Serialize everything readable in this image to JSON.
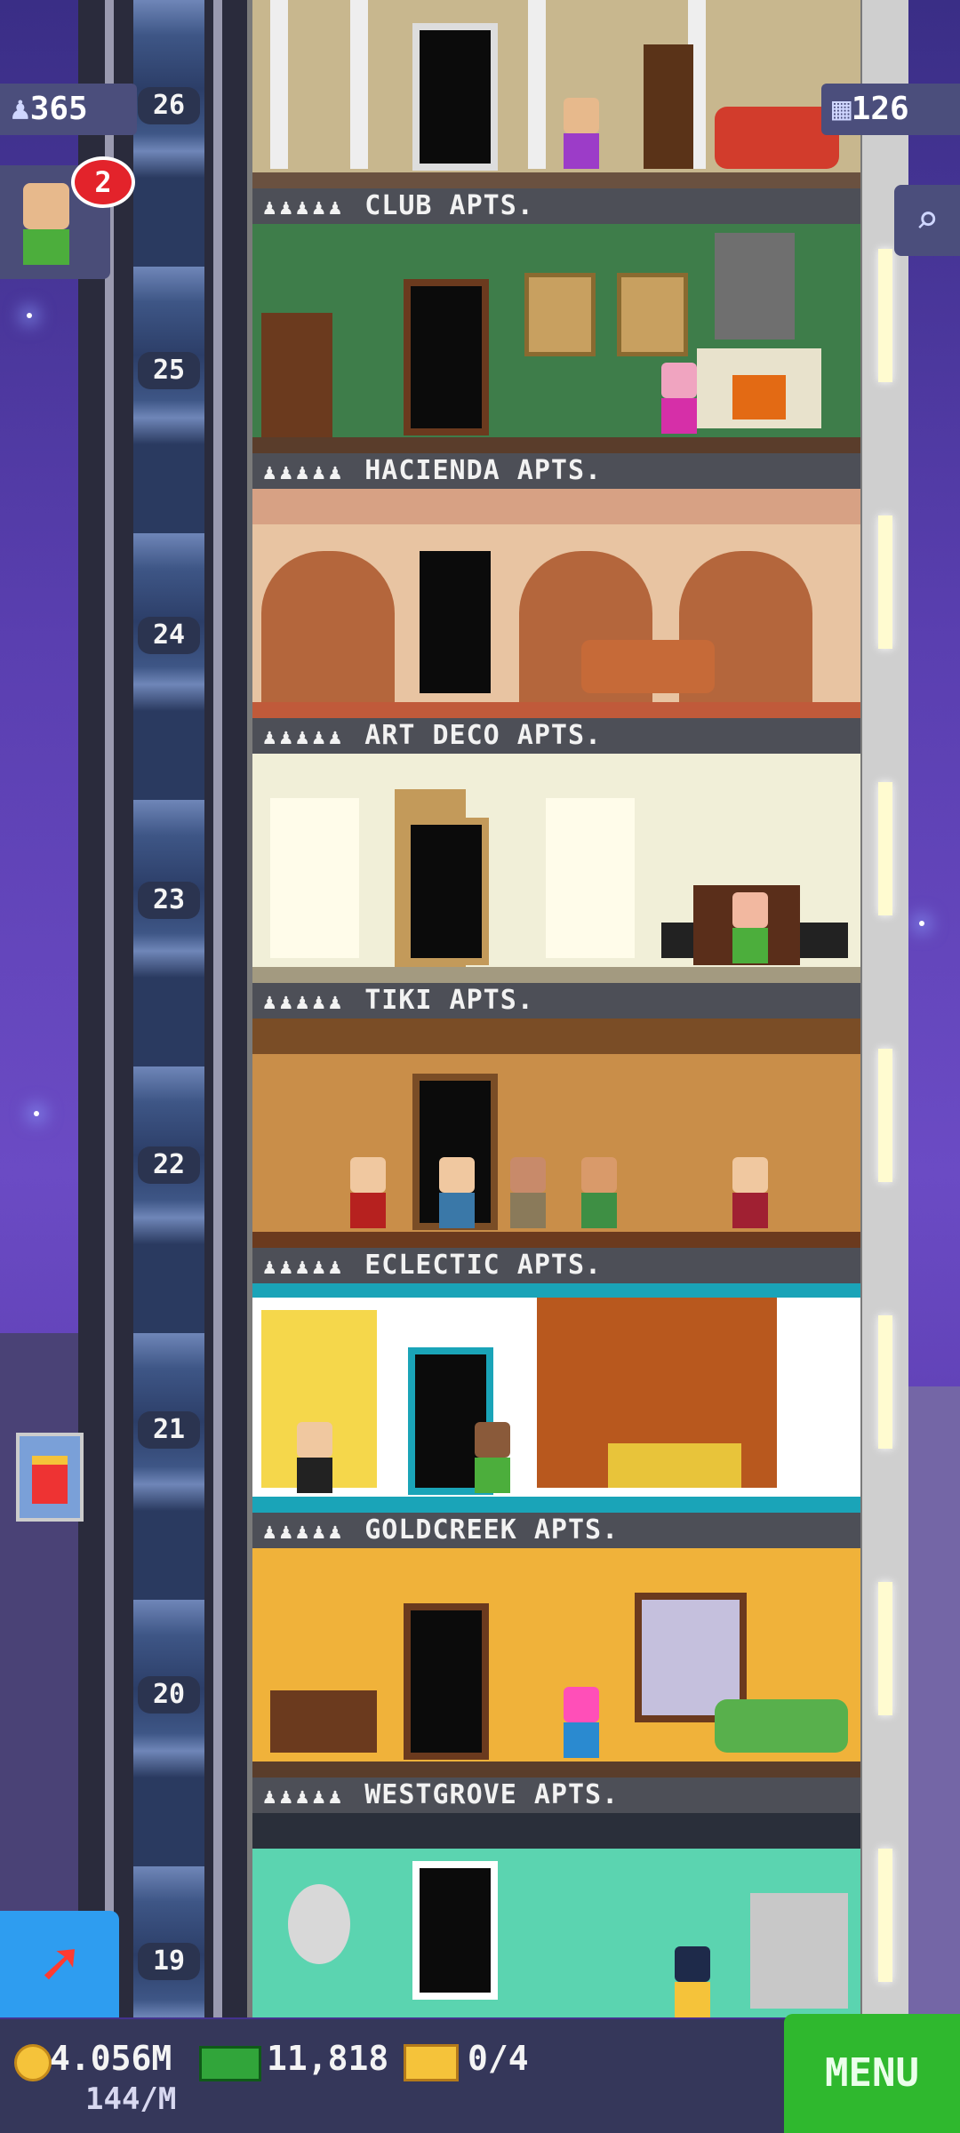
{
  "hud": {
    "population": "365",
    "floors_count": "126",
    "visitor_badge": "2",
    "search_icon": "magnifier-icon"
  },
  "floors": [
    {
      "number": "26",
      "name": "CLUB APTS.",
      "theme": "club",
      "wall": "#c8b78e"
    },
    {
      "number": "25",
      "name": "HACIENDA APTS.",
      "theme": "hacienda",
      "wall": "#3e7d4a"
    },
    {
      "number": "24",
      "name": "ART DECO APTS.",
      "theme": "artdeco",
      "wall": "#e8c4a2"
    },
    {
      "number": "23",
      "name": "TIKI APTS.",
      "theme": "tiki",
      "wall": "#f1efd8"
    },
    {
      "number": "22",
      "name": "ECLECTIC APTS.",
      "theme": "eclectic",
      "wall": "#c98e49"
    },
    {
      "number": "21",
      "name": "GOLDCREEK APTS.",
      "theme": "goldcreek",
      "wall": "#ffffff"
    },
    {
      "number": "20",
      "name": "WESTGROVE APTS.",
      "theme": "westgrove",
      "wall": "#f0b23a"
    },
    {
      "number": "19",
      "name": "",
      "theme": "teal",
      "wall": "#5bd4b0"
    }
  ],
  "footer": {
    "coins": "4.056M",
    "coins_rate": "144/M",
    "bux": "11,818",
    "tickets": "0/4",
    "menu_label": "MENU"
  }
}
